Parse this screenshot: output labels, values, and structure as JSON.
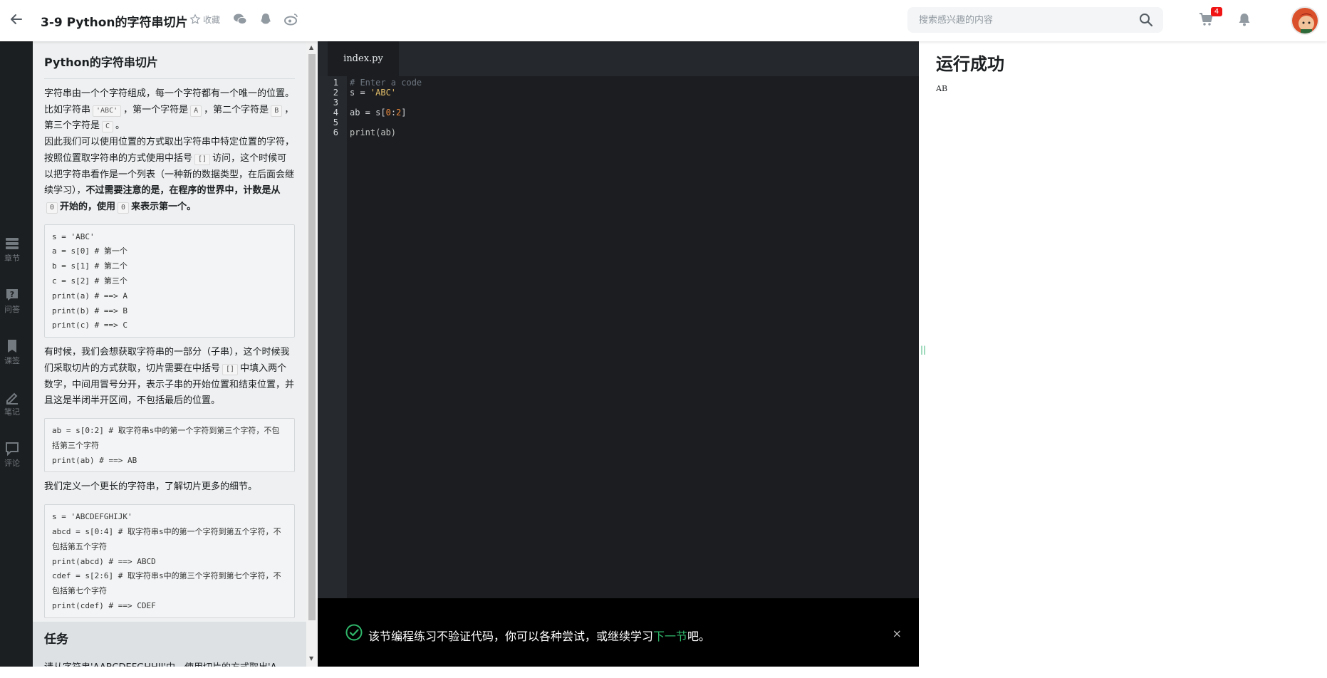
{
  "header": {
    "title": "3-9 Python的字符串切片",
    "favorite_label": "收藏",
    "search_placeholder": "搜索感兴趣的内容",
    "cart_count": "4"
  },
  "rail": {
    "items": [
      {
        "label": "章节",
        "icon": "chapters-icon"
      },
      {
        "label": "问答",
        "icon": "qa-icon"
      },
      {
        "label": "课签",
        "icon": "bookmark-icon"
      },
      {
        "label": "笔记",
        "icon": "note-icon"
      },
      {
        "label": "评论",
        "icon": "comment-icon"
      }
    ]
  },
  "lesson": {
    "heading": "Python的字符串切片",
    "p1_a": "字符串由一个个字符组成，每一个字符都有一个唯一的位置。比如字符串",
    "p1_code1": "'ABC'",
    "p1_b": "，第一个字符是",
    "p1_code2": "A",
    "p1_c": "，第二个字符是",
    "p1_code3": "B",
    "p1_d": "，第三个字符是",
    "p1_code4": "C",
    "p1_e": "。",
    "p2_a": "因此我们可以使用位置的方式取出字符串中特定位置的字符，按照位置取字符串的方式使用中括号",
    "p2_code1": "[]",
    "p2_b": "访问，这个时候可以把字符串看作是一个列表（一种新的数据类型，在后面会继续学习），",
    "p2_bold_a": "不过需要注意的是，在程序的世界中，计数是从",
    "p2_code2": "0",
    "p2_bold_b": "开始的，使用",
    "p2_code3": "0",
    "p2_bold_c": "来表示第一个。",
    "code1": "s = 'ABC'\na = s[0] # 第一个\nb = s[1] # 第二个\nc = s[2] # 第三个\nprint(a) # ==> A\nprint(b) # ==> B\nprint(c) # ==> C",
    "p3_a": "有时候，我们会想获取字符串的一部分（子串），这个时候我们采取切片的方式获取，切片需要在中括号",
    "p3_code1": "[]",
    "p3_b": "中填入两个数字，中间用冒号分开，表示子串的开始位置和结束位置，并且这是半闭半开区间，不包括最后的位置。",
    "code2": "ab = s[0:2] # 取字符串s中的第一个字符到第三个字符，不包括第三个字符\nprint(ab) # ==> AB",
    "p4": "我们定义一个更长的字符串，了解切片更多的细节。",
    "code3": "s = 'ABCDEFGHIJK'\nabcd = s[0:4] # 取字符串s中的第一个字符到第五个字符，不包括第五个字符\nprint(abcd) # ==> ABCD\ncdef = s[2:6] # 取字符串s中的第三个字符到第七个字符，不包括第七个字符\nprint(cdef) # ==> CDEF",
    "task_heading": "任务",
    "task_text": "请从字符串'AABCDEFGHHIJ'中，使用切片的方式取出'A"
  },
  "editor": {
    "tab": "index.py",
    "line_numbers": [
      "1",
      "2",
      "3",
      "4",
      "5",
      "6"
    ],
    "l1": "# Enter a code",
    "l2_a": "s = ",
    "l2_b": "'ABC'",
    "l4_a": "ab = s[",
    "l4_b": "0",
    "l4_c": ":",
    "l4_d": "2",
    "l4_e": "]",
    "l6": "print(ab)"
  },
  "notice": {
    "text_a": "该节编程练习不验证代码，你可以各种尝试，或继续学习",
    "link": "下一节",
    "text_b": "吧。",
    "close": "×"
  },
  "output": {
    "heading": "运行成功",
    "result": "AB"
  }
}
